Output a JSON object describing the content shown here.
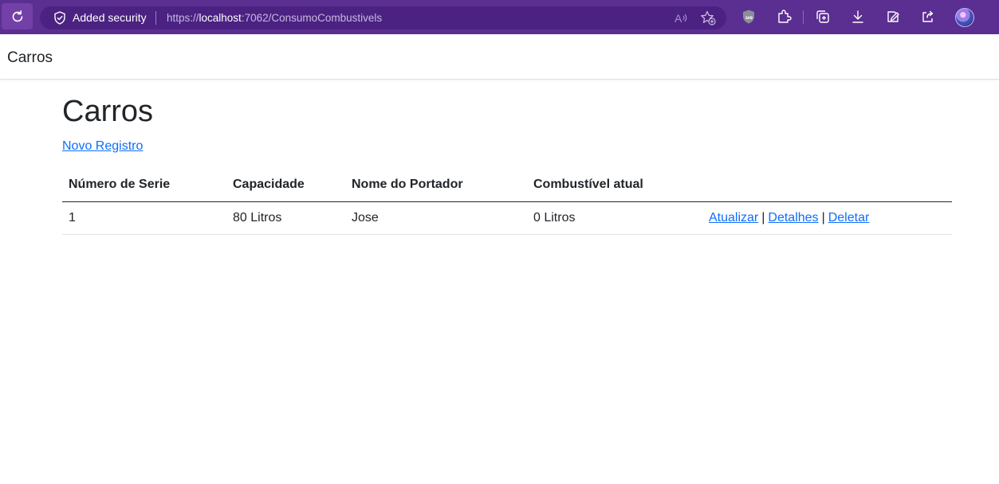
{
  "browser": {
    "security_label": "Added security",
    "url_prefix": "https://",
    "url_host": "localhost",
    "url_rest": ":7062/ConsumoCombustivels"
  },
  "navbar": {
    "brand": "Carros"
  },
  "main": {
    "title": "Carros",
    "new_link": "Novo Registro",
    "table": {
      "headers": [
        "Número de Serie",
        "Capacidade",
        "Nome do Portador",
        "Combustível atual",
        ""
      ],
      "rows": [
        {
          "serie": "1",
          "capacidade": "80 Litros",
          "portador": "Jose",
          "combustivel": "0 Litros",
          "actions": [
            "Atualizar",
            "Detalhes",
            "Deletar"
          ],
          "separator": "|"
        }
      ]
    }
  },
  "colors": {
    "browser_bar": "#5b2e91",
    "link": "#0d6efd",
    "text": "#212529"
  },
  "icons": [
    "reload-icon",
    "shield-icon",
    "read-aloud-icon",
    "favorite-add-icon",
    "ublock-icon",
    "extensions-icon",
    "collections-icon",
    "downloads-icon",
    "browser-essentials-icon",
    "share-icon",
    "profile-avatar"
  ]
}
